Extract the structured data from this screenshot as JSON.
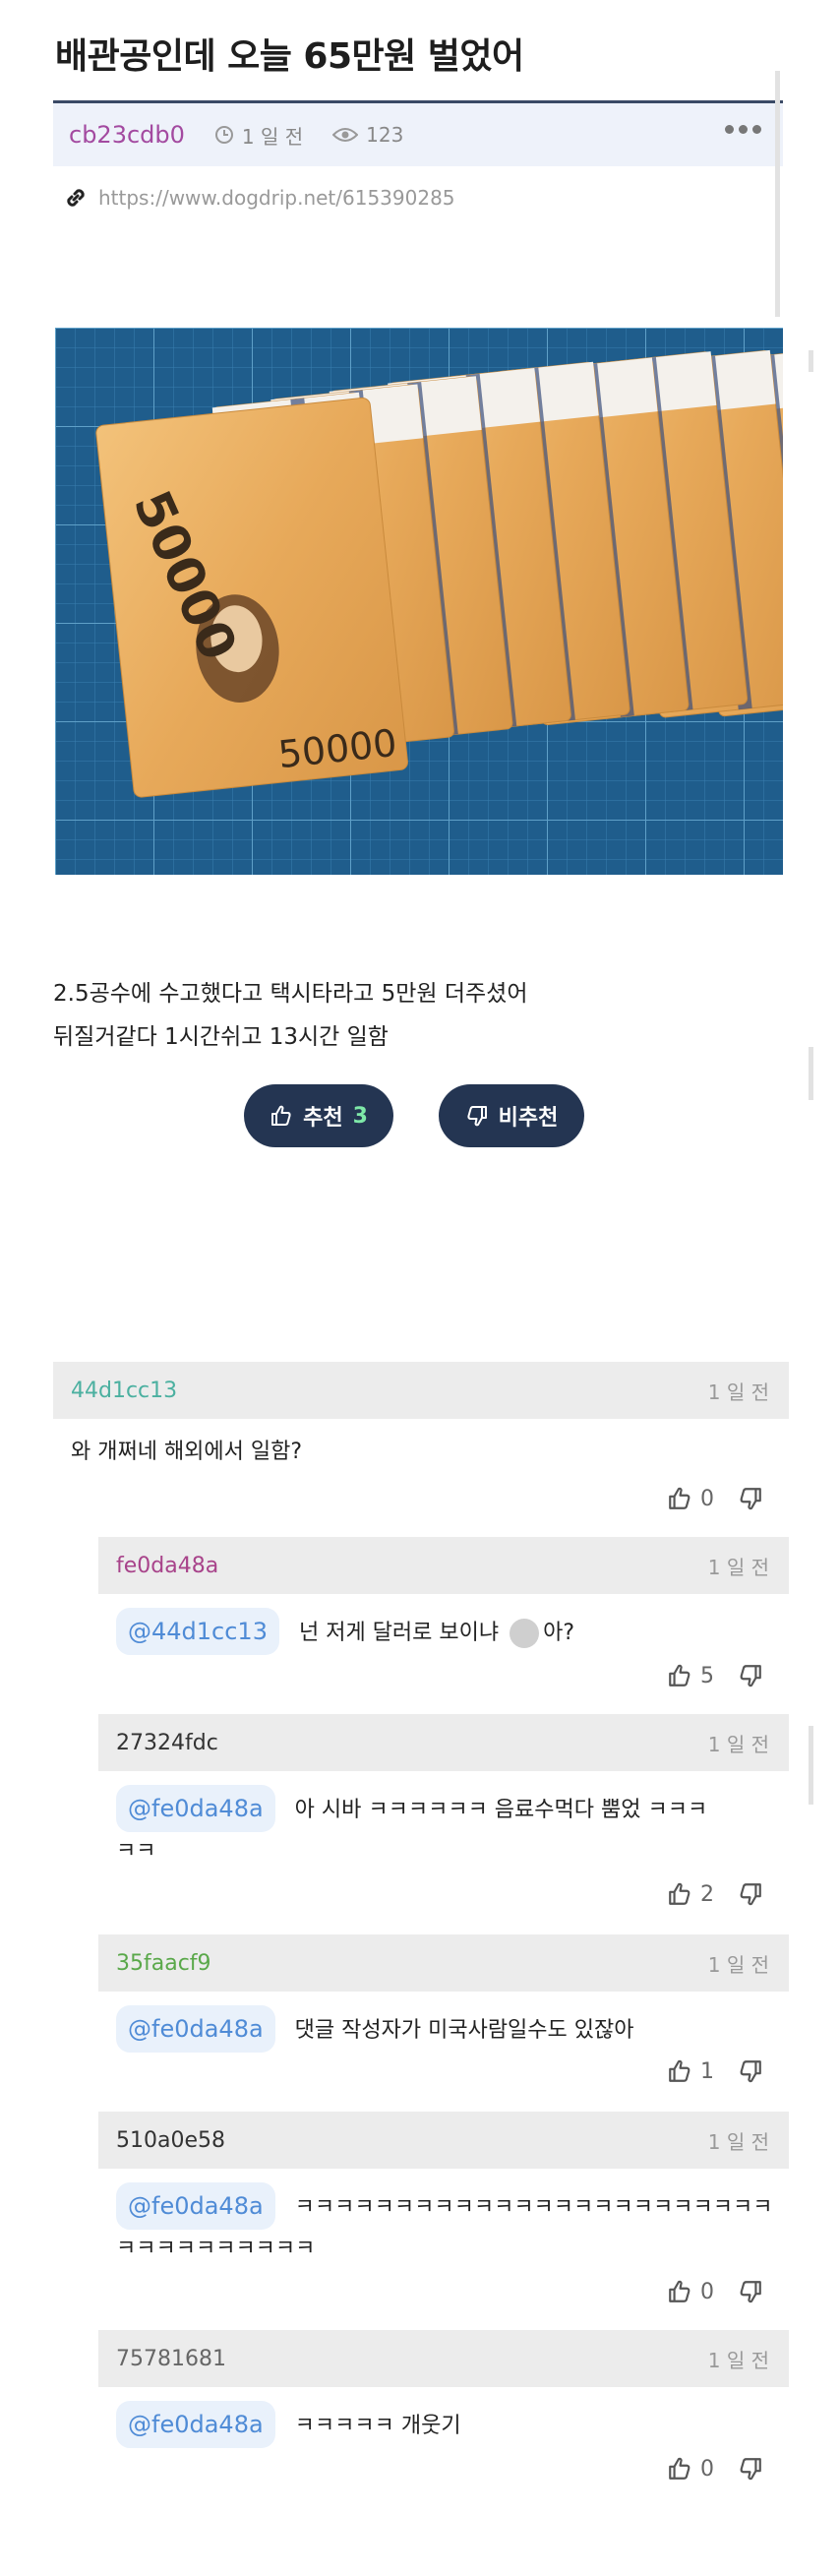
{
  "post": {
    "title": "배관공인데 오늘 65만원 벌었어",
    "author": "cb23cdb0",
    "time": "1 일 전",
    "views": "123",
    "url": "https://www.dogdrip.net/615390285",
    "body_lines": [
      "2.5공수에 수고했다고 택시타라고 5만원 더주셨어",
      "뒤질거같다 1시간쉬고 13시간 일함"
    ],
    "image_text": {
      "denomination": "50000",
      "short": "5"
    },
    "upvote_label": "추천",
    "upvote_count": "3",
    "downvote_label": "비추천"
  },
  "colors": {
    "header_bar": "#3a4a66",
    "meta_bg": "#eef2fa",
    "author": "#a34aa0",
    "vote_button": "#243552",
    "vote_count": "#7ee8a8",
    "comment_header_bg": "#ececec",
    "mention_bg": "#e9f1fb",
    "mention_text": "#4f8bd6"
  },
  "comments": [
    {
      "author": "44d1cc13",
      "author_color": "#4bb0a0",
      "time": "1 일 전",
      "mention": "",
      "line1": "와 개쩌네 해외에서 일함?",
      "line2": "",
      "likes": "0"
    },
    {
      "author": "fe0da48a",
      "author_color": "#a8438a",
      "time": "1 일 전",
      "mention": "@44d1cc13",
      "line1": "넌 저게 달러로 보이냐 ",
      "line2": "아?",
      "likes": "5"
    },
    {
      "author": "27324fdc",
      "author_color": "#333333",
      "time": "1 일 전",
      "mention": "@fe0da48a",
      "line1": "아 시바 ㅋㅋㅋㅋㅋㅋ 음료수먹다 뿜었     ㅋㅋㅋ",
      "line2": "ㅋㅋ",
      "likes": "2"
    },
    {
      "author": "35faacf9",
      "author_color": "#5aa84a",
      "time": "1 일 전",
      "mention": "@fe0da48a",
      "line1": "댓글 작성자가 미국사람일수도 있잖아",
      "line2": "",
      "likes": "1"
    },
    {
      "author": "510a0e58",
      "author_color": "#333333",
      "time": "1 일 전",
      "mention": "@fe0da48a",
      "line1": "ㅋㅋㅋㅋㅋㅋㅋㅋㅋㅋㅋㅋㅋㅋㅋㅋㅋㅋㅋㅋㅋㅋㅋㅋ",
      "line2": "ㅋㅋㅋㅋㅋㅋㅋㅋㅋㅋ",
      "likes": "0"
    },
    {
      "author": "75781681",
      "author_color": "#666666",
      "time": "1 일 전",
      "mention": "@fe0da48a",
      "line1": "ㅋㅋㅋㅋㅋ 개웃기",
      "line2": "",
      "likes": "0"
    }
  ]
}
